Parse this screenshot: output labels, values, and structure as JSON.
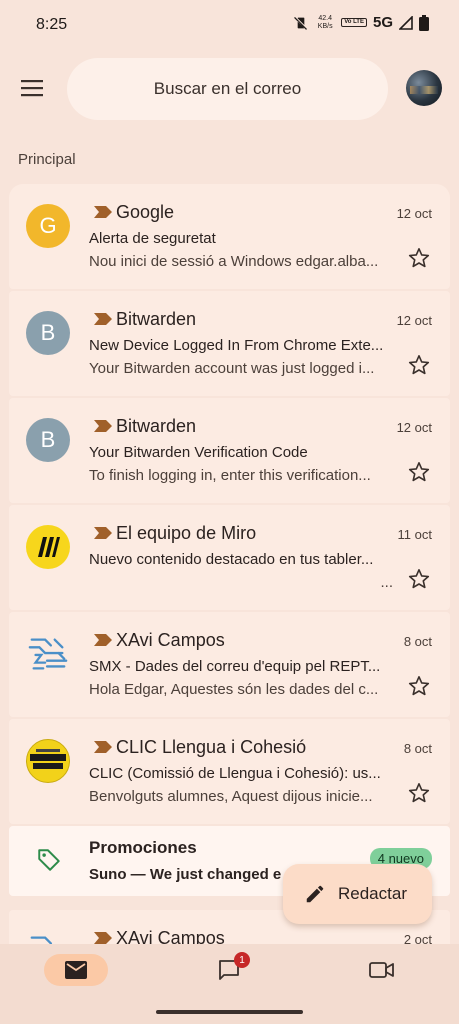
{
  "status_bar": {
    "time": "8:25",
    "speed_value": "42.4",
    "speed_unit": "KB/s",
    "volte": "Vo LTE",
    "network": "5G"
  },
  "header": {
    "search_placeholder": "Buscar en el correo"
  },
  "section_label": "Principal",
  "emails": [
    {
      "sender": "Google",
      "date": "12 oct",
      "subject": "Alerta de seguretat",
      "snippet": "Nou inici de sessió a Windows edgar.alba...",
      "avatar_letter": "G",
      "avatar_color": "#f2b72b"
    },
    {
      "sender": "Bitwarden",
      "date": "12 oct",
      "subject": "New Device Logged In From Chrome Exte...",
      "snippet": "Your Bitwarden account was just logged i...",
      "avatar_letter": "B",
      "avatar_color": "#8aa0ad"
    },
    {
      "sender": "Bitwarden",
      "date": "12 oct",
      "subject": "Your Bitwarden Verification Code",
      "snippet": "To finish logging in, enter this verification...",
      "avatar_letter": "B",
      "avatar_color": "#8aa0ad"
    },
    {
      "sender": "El equipo de Miro",
      "date": "11 oct",
      "subject": "Nuevo contenido destacado en tus tabler...",
      "snippet": "...",
      "avatar_letter": "",
      "avatar_color": "#f7d61c"
    },
    {
      "sender": "XAvi Campos",
      "date": "8 oct",
      "subject": "SMX - Dades del correu d'equip pel REPT...",
      "snippet": "Hola Edgar, Aquestes són les dades del c...",
      "avatar_letter": "",
      "avatar_color": "#ffffff"
    },
    {
      "sender": "CLIC Llengua i Cohesió",
      "date": "8 oct",
      "subject": "CLIC (Comissió de Llengua i Cohesió): us...",
      "snippet": "Benvolguts alumnes, Aquest dijous inicie...",
      "avatar_letter": "",
      "avatar_color": "#f2d21a"
    }
  ],
  "promotions": {
    "title": "Promociones",
    "text": "Suno — We just changed e",
    "badge": "4 nuevo"
  },
  "partial_email": {
    "sender": "XAvi Campos",
    "date": "2 oct"
  },
  "fab": {
    "label": "Redactar"
  },
  "bottom_nav": {
    "chat_badge": "1"
  },
  "colors": {
    "background": "#f8e4da",
    "card": "#fcebe2",
    "important": "#a0602a",
    "nav_active": "#fbc9a6",
    "badge_green": "#7fcf9a",
    "badge_red": "#c62828"
  }
}
